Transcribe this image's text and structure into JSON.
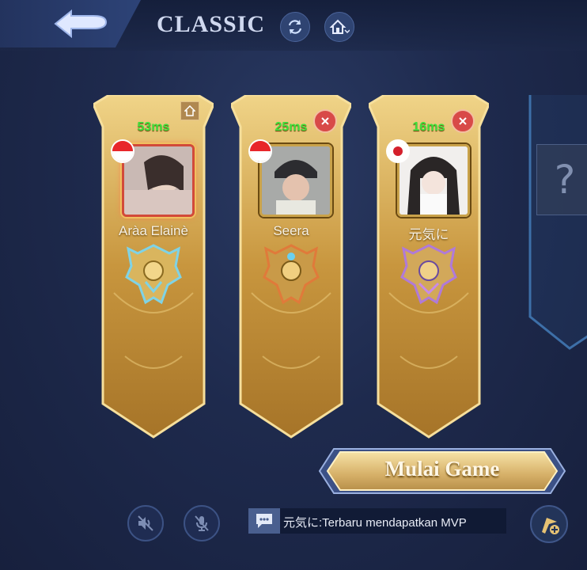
{
  "header": {
    "mode_title": "CLASSIC",
    "back_icon": "back-arrow-icon",
    "refresh_icon": "refresh-icon",
    "home_icon": "home-icon"
  },
  "players": [
    {
      "ping": "53ms",
      "name": "Aràa Elainè",
      "flag": "Indonesia",
      "rank_icon": "rank-emblem-icon",
      "is_host": true
    },
    {
      "ping": "25ms",
      "name": "Seera",
      "flag": "Indonesia",
      "rank_icon": "rank-emblem-icon",
      "is_host": false
    },
    {
      "ping": "16ms",
      "name": "元気に",
      "flag": "Japan",
      "rank_icon": "rank-emblem-icon",
      "is_host": false
    }
  ],
  "empty_slot": {
    "symbol": "?"
  },
  "start_button": {
    "label": "Mulai Game"
  },
  "chat": {
    "message": "元気に:Terbaru mendapatkan MVP"
  },
  "colors": {
    "accent_gold": "#d8b25a",
    "ping_green": "#3fe23b",
    "close_red": "#d84a48"
  }
}
